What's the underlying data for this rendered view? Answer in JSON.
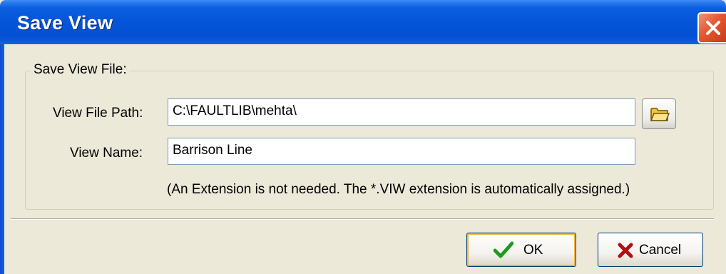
{
  "window": {
    "title": "Save View"
  },
  "group": {
    "label": "Save View File:"
  },
  "fields": {
    "path_label": "View File Path:",
    "path_value": "C:\\FAULTLIB\\mehta\\",
    "name_label": "View Name:",
    "name_value": "Barrison Line"
  },
  "hint": "(An Extension is not needed. The *.VIW extension is automatically assigned.)",
  "buttons": {
    "ok": "OK",
    "cancel": "Cancel"
  },
  "icons": {
    "close": "close-icon",
    "browse": "folder-icon",
    "ok": "checkmark-icon",
    "cancel": "x-mark-icon"
  },
  "colors": {
    "titlebar": "#0554d8",
    "dialog_bg": "#ece9d8",
    "close_button": "#e5552f",
    "ok_check": "#1f9a1f",
    "cancel_x": "#b01010"
  }
}
